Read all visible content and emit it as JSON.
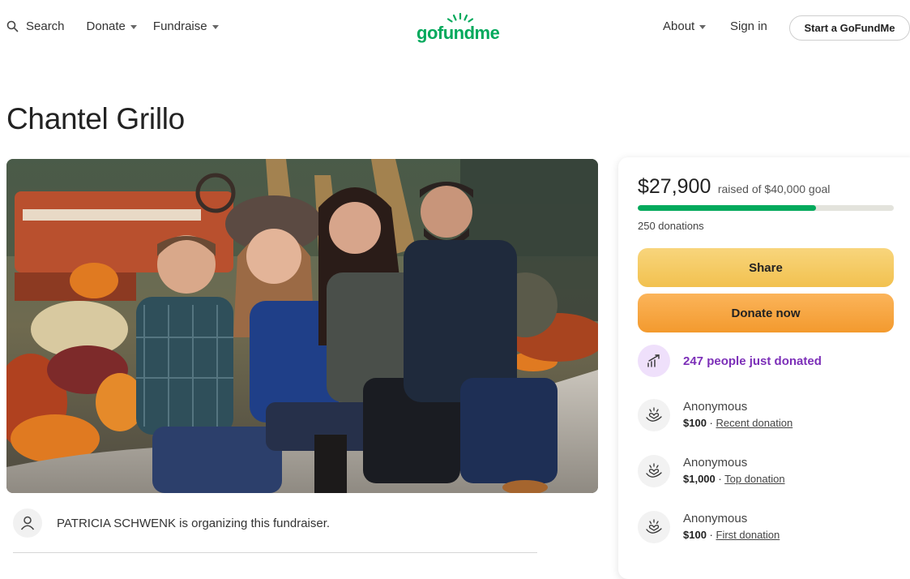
{
  "nav": {
    "search_label": "Search",
    "donate_label": "Donate",
    "fundraise_label": "Fundraise",
    "about_label": "About",
    "signin_label": "Sign in",
    "start_label": "Start a GoFundMe"
  },
  "logo": {
    "text": "gofundme",
    "color": "#02a95c"
  },
  "campaign": {
    "title": "Chantel Grillo",
    "organizer_text": "PATRICIA SCHWENK is organizing this fundraiser."
  },
  "donation_card": {
    "raised_amount": "$27,900",
    "raised_text": "raised of $40,000 goal",
    "progress_fraction": 0.6975,
    "donation_count": "250 donations",
    "share_label": "Share",
    "donate_label": "Donate now",
    "trend_text": "247 people just donated",
    "donors": [
      {
        "name": "Anonymous",
        "amount": "$100",
        "tag": "Recent donation"
      },
      {
        "name": "Anonymous",
        "amount": "$1,000",
        "tag": "Top donation"
      },
      {
        "name": "Anonymous",
        "amount": "$100",
        "tag": "First donation"
      }
    ]
  },
  "colors": {
    "brand_green": "#02a95c",
    "share_yellow": "#f2c14f",
    "donate_orange": "#f39a2e",
    "trend_purple": "#7c2fb8"
  },
  "icons": [
    "search-icon",
    "sun-logo-icon",
    "user-icon",
    "trending-up-icon",
    "heart-hand-icon"
  ]
}
